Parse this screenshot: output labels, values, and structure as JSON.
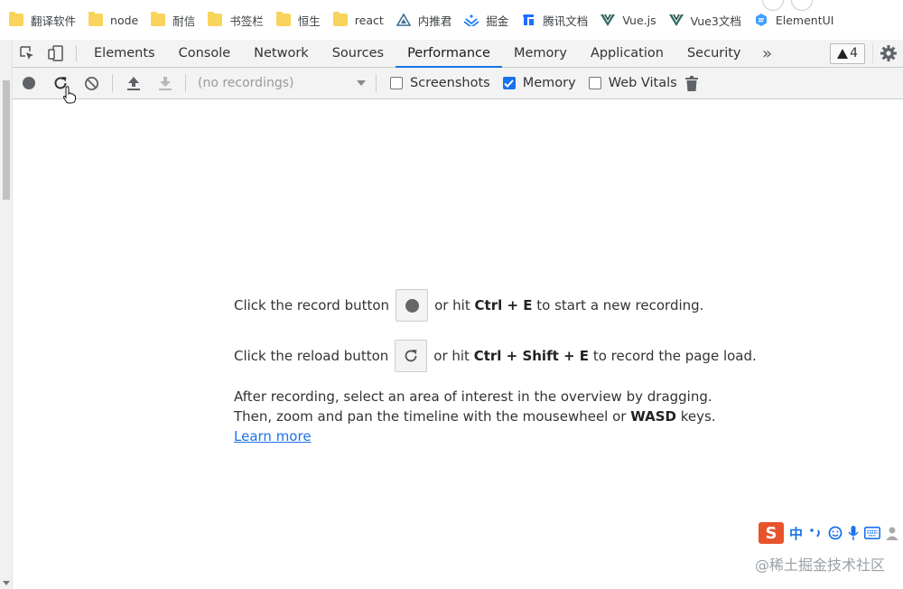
{
  "bookmarks": [
    {
      "label": "翻译软件",
      "icon": "folder-icon"
    },
    {
      "label": "node",
      "icon": "folder-icon"
    },
    {
      "label": "耐信",
      "icon": "folder-icon"
    },
    {
      "label": "书签栏",
      "icon": "folder-icon"
    },
    {
      "label": "恒生",
      "icon": "folder-icon"
    },
    {
      "label": "react",
      "icon": "folder-icon"
    },
    {
      "label": "内推君",
      "icon": "triangle-logo-icon"
    },
    {
      "label": "掘金",
      "icon": "juejin-logo-icon"
    },
    {
      "label": "腾讯文档",
      "icon": "tencent-docs-icon"
    },
    {
      "label": "Vue.js",
      "icon": "vue-logo-icon"
    },
    {
      "label": "Vue3文档",
      "icon": "vue-logo-icon"
    },
    {
      "label": "ElementUI",
      "icon": "element-logo-icon"
    }
  ],
  "devtools": {
    "tabs": [
      {
        "label": "Elements",
        "active": false
      },
      {
        "label": "Console",
        "active": false
      },
      {
        "label": "Network",
        "active": false
      },
      {
        "label": "Sources",
        "active": false
      },
      {
        "label": "Performance",
        "active": true
      },
      {
        "label": "Memory",
        "active": false
      },
      {
        "label": "Application",
        "active": false
      },
      {
        "label": "Security",
        "active": false
      }
    ],
    "more_tabs": "»",
    "warning_count": "4",
    "accent_color": "#1a73e8"
  },
  "toolbar": {
    "recordings_placeholder": "(no recordings)",
    "screenshots_label": "Screenshots",
    "screenshots_checked": false,
    "memory_label": "Memory",
    "memory_checked": true,
    "web_vitals_label": "Web Vitals",
    "web_vitals_checked": false
  },
  "landing": {
    "record_prefix": "Click the record button",
    "record_mid": "or hit",
    "record_shortcut": "Ctrl + E",
    "record_suffix": "to start a new recording.",
    "reload_prefix": "Click the reload button",
    "reload_mid": "or hit",
    "reload_shortcut": "Ctrl + Shift + E",
    "reload_suffix": "to record the page load.",
    "after_text_1": "After recording, select an area of interest in the overview by dragging. Then, zoom and pan the timeline with the mousewheel or",
    "after_keys": "WASD",
    "after_text_2": "keys.",
    "learn_more": "Learn more"
  },
  "ime": {
    "logo": "S",
    "mode": "中"
  },
  "watermark": "@稀土掘金技术社区"
}
